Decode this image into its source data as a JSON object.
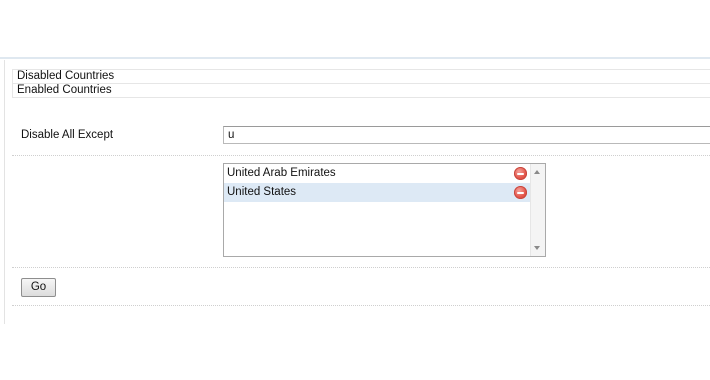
{
  "tabs": [
    {
      "label": "Disabled Countries"
    },
    {
      "label": "Enabled Countries"
    }
  ],
  "filter": {
    "label": "Disable All Except",
    "value": "u"
  },
  "countries": [
    {
      "name": "United Arab Emirates",
      "selected": false
    },
    {
      "name": "United States",
      "selected": true
    }
  ],
  "actions": {
    "go_label": "Go"
  },
  "colors": {
    "selection": "#dde9f5",
    "remove": "#e4574c"
  }
}
